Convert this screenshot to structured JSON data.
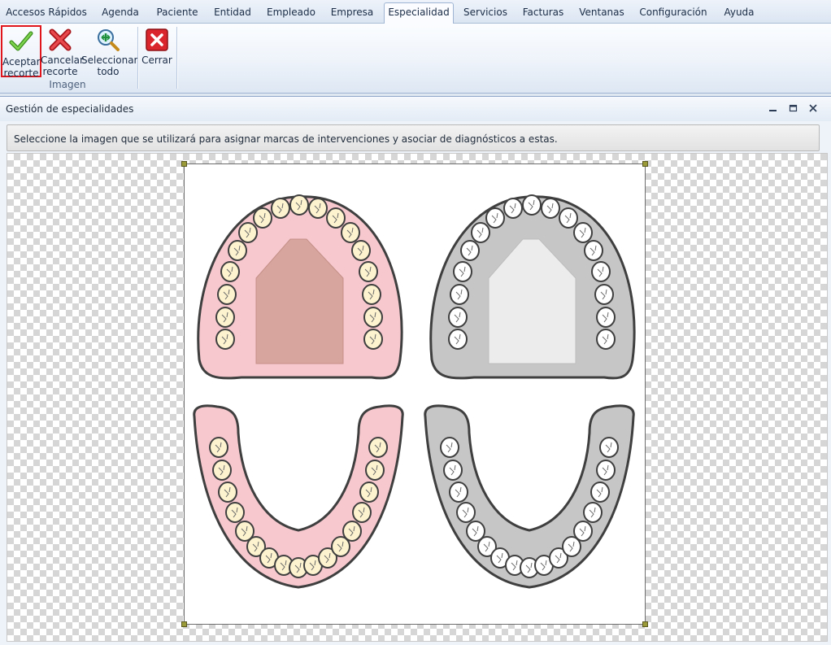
{
  "menu": {
    "tabs": [
      {
        "label": "Accesos Rápidos",
        "active": false
      },
      {
        "label": "Agenda",
        "active": false
      },
      {
        "label": "Paciente",
        "active": false
      },
      {
        "label": "Entidad",
        "active": false
      },
      {
        "label": "Empleado",
        "active": false
      },
      {
        "label": "Empresa",
        "active": false
      },
      {
        "label": "Especialidad",
        "active": true
      },
      {
        "label": "Servicios",
        "active": false
      },
      {
        "label": "Facturas",
        "active": false
      },
      {
        "label": "Ventanas",
        "active": false
      },
      {
        "label": "Configuración",
        "active": false
      },
      {
        "label": "Ayuda",
        "active": false
      }
    ]
  },
  "ribbon": {
    "accept": {
      "line1": "Aceptar",
      "line2": "recorte",
      "icon": "checkmark-icon",
      "selected": true
    },
    "cancel": {
      "line1": "Cancelar",
      "line2": "recorte",
      "icon": "red-x-icon"
    },
    "select_all": {
      "line1": "Seleccionar",
      "line2": "todo",
      "icon": "select-all-icon"
    },
    "group_label": "Imagen",
    "close": {
      "label": "Cerrar",
      "icon": "close-icon"
    }
  },
  "window": {
    "title": "Gestión de especialidades",
    "controls": [
      "minimize-icon",
      "restore-icon",
      "close-icon"
    ],
    "hint": "Seleccione la imagen que se utilizará para asignar marcas de intervenciones y asociar de diagnósticos a estas."
  },
  "colors": {
    "accent_selected": "#e0151b",
    "gum_pink": "#f7c9cf",
    "palate_pink": "#d7a59d",
    "gum_gray": "#c6c6c6",
    "palate_gray": "#ececec",
    "tooth_cream": "#fdf3cf",
    "outline": "#3f3f3f"
  }
}
